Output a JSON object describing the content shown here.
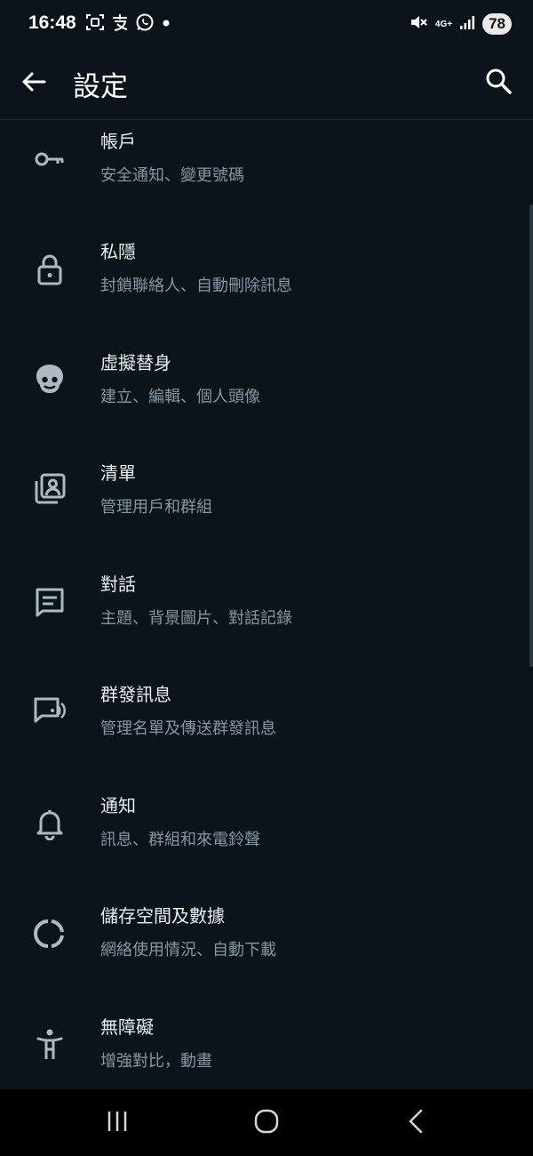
{
  "status_bar": {
    "time": "16:48",
    "network": "4G+",
    "battery": "78"
  },
  "app_bar": {
    "title": "設定"
  },
  "settings": {
    "items": [
      {
        "title": "帳戶",
        "subtitle": "安全通知、變更號碼",
        "icon": "key-icon"
      },
      {
        "title": "私隱",
        "subtitle": "封鎖聯絡人、自動刪除訊息",
        "icon": "lock-icon"
      },
      {
        "title": "虛擬替身",
        "subtitle": "建立、編輯、個人頭像",
        "icon": "avatar-icon"
      },
      {
        "title": "清單",
        "subtitle": "管理用戶和群組",
        "icon": "contact-list-icon"
      },
      {
        "title": "對話",
        "subtitle": "主題、背景圖片、對話記錄",
        "icon": "chat-icon"
      },
      {
        "title": "群發訊息",
        "subtitle": "管理名單及傳送群發訊息",
        "icon": "broadcast-icon"
      },
      {
        "title": "通知",
        "subtitle": "訊息、群組和來電鈴聲",
        "icon": "bell-icon"
      },
      {
        "title": "儲存空間及數據",
        "subtitle": "網絡使用情況、自動下載",
        "icon": "storage-icon"
      },
      {
        "title": "無障礙",
        "subtitle": "增強對比，動畫",
        "icon": "accessibility-icon"
      }
    ]
  },
  "colors": {
    "background": "#0b141a",
    "title_text": "#e9edef",
    "subtitle_text": "#8696a0",
    "icon": "#aebac1"
  }
}
